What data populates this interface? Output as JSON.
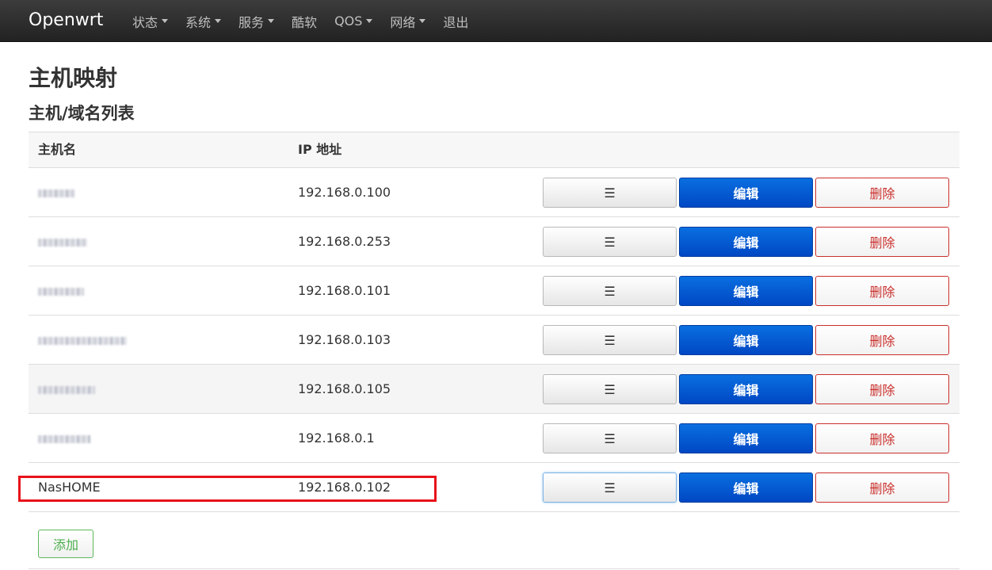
{
  "navbar": {
    "brand": "Openwrt",
    "items": [
      {
        "label": "状态",
        "dropdown": true
      },
      {
        "label": "系统",
        "dropdown": true
      },
      {
        "label": "服务",
        "dropdown": true
      },
      {
        "label": "酷软",
        "dropdown": false
      },
      {
        "label": "QOS",
        "dropdown": true
      },
      {
        "label": "网络",
        "dropdown": true
      },
      {
        "label": "退出",
        "dropdown": false
      }
    ]
  },
  "page": {
    "title": "主机映射",
    "section_title": "主机/域名列表"
  },
  "table": {
    "headers": {
      "hostname": "主机名",
      "ip": "IP 地址"
    },
    "rows": [
      {
        "hostname": "",
        "hostname_blurred": true,
        "ip": "192.168.0.100"
      },
      {
        "hostname": "",
        "hostname_blurred": true,
        "ip": "192.168.0.253"
      },
      {
        "hostname": "",
        "hostname_blurred": true,
        "ip": "192.168.0.101"
      },
      {
        "hostname": "",
        "hostname_blurred": true,
        "ip": "192.168.0.103"
      },
      {
        "hostname": "",
        "hostname_blurred": true,
        "ip": "192.168.0.105"
      },
      {
        "hostname": "",
        "hostname_blurred": true,
        "ip": "192.168.0.1"
      },
      {
        "hostname": "NasHOME",
        "hostname_blurred": false,
        "ip": "192.168.0.102"
      }
    ],
    "buttons": {
      "menu": "☰",
      "edit": "编辑",
      "delete": "删除"
    }
  },
  "actions": {
    "add_label": "添加"
  },
  "colors": {
    "navbar_bg": "#222222",
    "edit_button": "#0055d6",
    "delete_text": "#c9302c",
    "add_text": "#4cae4c",
    "highlight": "#e8121a"
  }
}
